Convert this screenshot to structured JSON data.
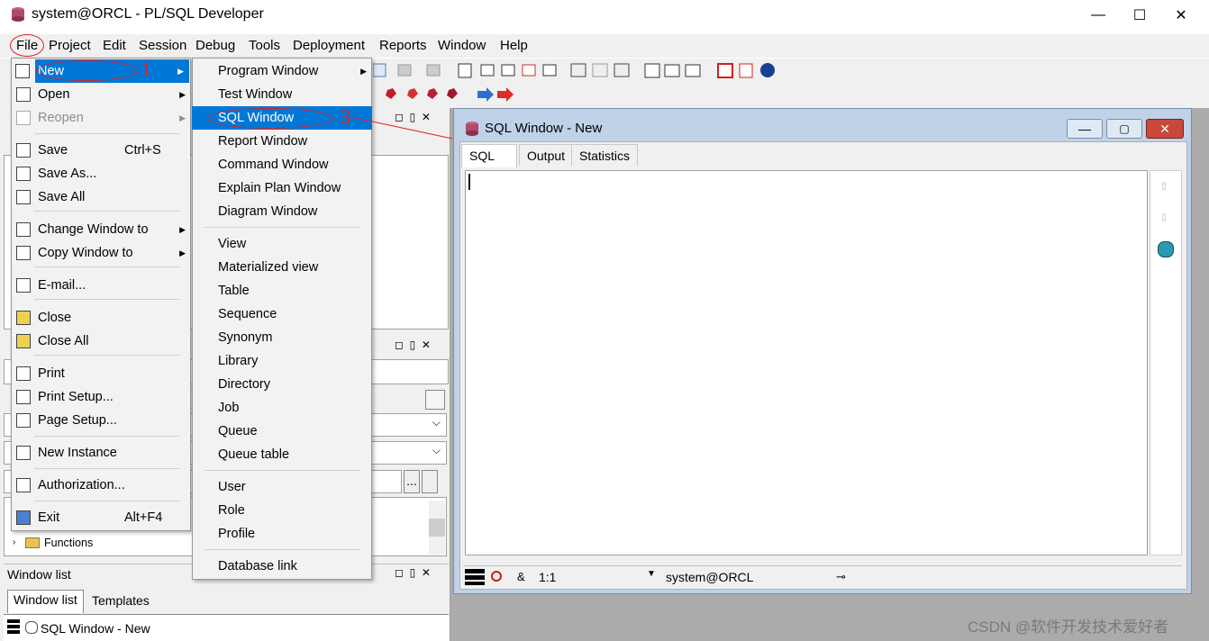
{
  "window": {
    "title": "system@ORCL - PL/SQL Developer",
    "min": "—",
    "max": "☐",
    "close": "✕"
  },
  "menubar": [
    "File",
    "Project",
    "Edit",
    "Session",
    "Debug",
    "Tools",
    "Deployment",
    "Reports",
    "Window",
    "Help"
  ],
  "file_menu": {
    "items": [
      {
        "label": "New",
        "submenu": true,
        "selected": true
      },
      {
        "label": "Open",
        "submenu": true
      },
      {
        "label": "Reopen",
        "submenu": true,
        "disabled": true
      },
      {
        "label": "Save",
        "shortcut": "Ctrl+S"
      },
      {
        "label": "Save As..."
      },
      {
        "label": "Save All"
      },
      {
        "label": "Change Window to",
        "submenu": true
      },
      {
        "label": "Copy Window to",
        "submenu": true
      },
      {
        "label": "E-mail..."
      },
      {
        "label": "Close"
      },
      {
        "label": "Close All"
      },
      {
        "label": "Print"
      },
      {
        "label": "Print Setup..."
      },
      {
        "label": "Page Setup..."
      },
      {
        "label": "New Instance"
      },
      {
        "label": "Authorization..."
      },
      {
        "label": "Exit",
        "shortcut": "Alt+F4"
      }
    ]
  },
  "new_submenu": {
    "items": [
      {
        "label": "Program Window",
        "submenu": true
      },
      {
        "label": "Test Window"
      },
      {
        "label": "SQL Window",
        "selected": true
      },
      {
        "label": "Report Window"
      },
      {
        "label": "Command Window"
      },
      {
        "label": "Explain Plan Window"
      },
      {
        "label": "Diagram Window"
      },
      {
        "label": "View"
      },
      {
        "label": "Materialized view"
      },
      {
        "label": "Table"
      },
      {
        "label": "Sequence"
      },
      {
        "label": "Synonym"
      },
      {
        "label": "Library"
      },
      {
        "label": "Directory"
      },
      {
        "label": "Job"
      },
      {
        "label": "Queue"
      },
      {
        "label": "Queue table"
      },
      {
        "label": "User"
      },
      {
        "label": "Role"
      },
      {
        "label": "Profile"
      },
      {
        "label": "Database link"
      }
    ]
  },
  "annotations": {
    "n1": "1",
    "n3": "3"
  },
  "left_panel": {
    "tree_item": "Functions",
    "window_list_title": "Window list",
    "tabs": [
      "Window list",
      "Templates"
    ],
    "window_list_item": "SQL Window - New",
    "ellipsis": "..."
  },
  "sql_window": {
    "title": "SQL Window - New",
    "tabs": [
      "SQL",
      "Output",
      "Statistics"
    ],
    "status": {
      "amp": "&",
      "pos": "1:1",
      "conn": "system@ORCL"
    }
  },
  "watermark": "CSDN @软件开发技术爱好者",
  "colors": {
    "menu_highlight": "#0078d7",
    "annotation_red": "#e02020"
  }
}
